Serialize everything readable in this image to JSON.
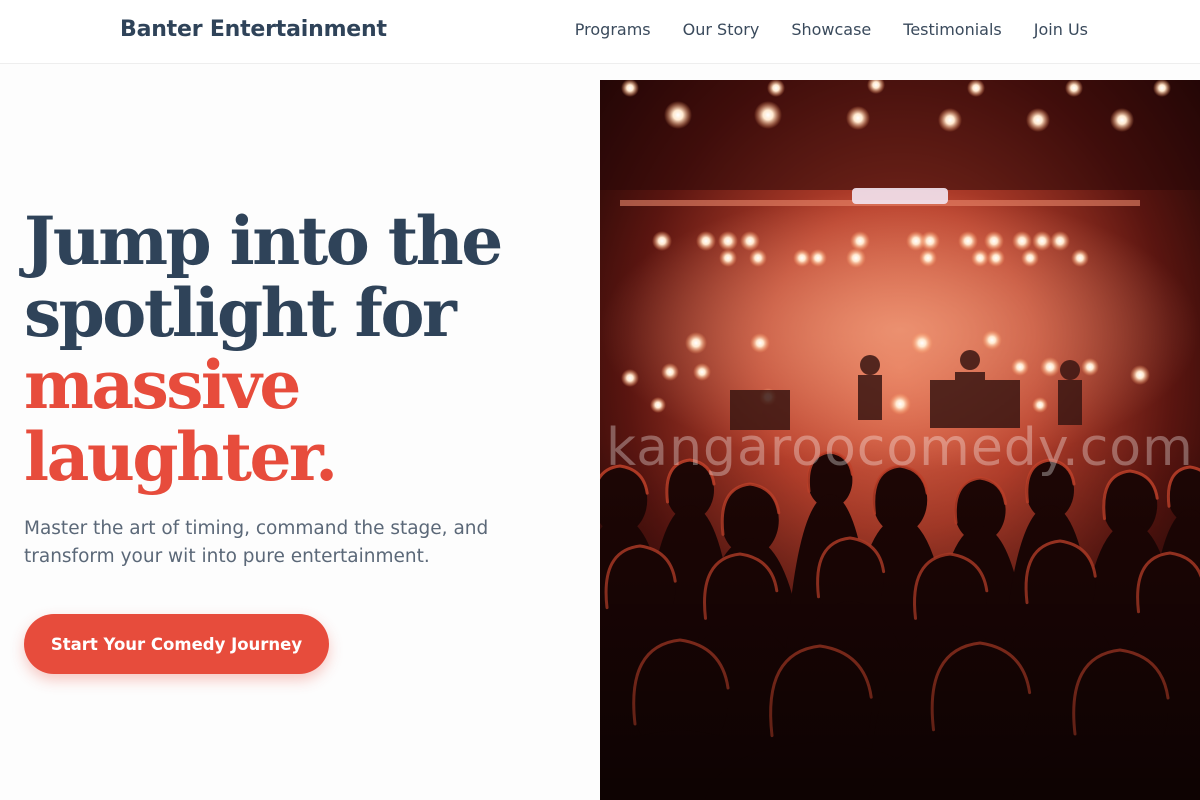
{
  "header": {
    "brand": "Banter Entertainment",
    "nav": [
      "Programs",
      "Our Story",
      "Showcase",
      "Testimonials",
      "Join Us"
    ]
  },
  "hero": {
    "headline_line1": "Jump into the",
    "headline_line2": "spotlight for",
    "headline_accent1": "massive",
    "headline_accent2": "laughter.",
    "subtitle": "Master the art of timing, command the stage, and transform your wit into pure entertainment.",
    "cta_label": "Start Your Comedy Journey",
    "image_watermark": "kangaroocomedy.com"
  },
  "colors": {
    "primary_text": "#2f4359",
    "accent": "#e74c3c",
    "muted_text": "#5b6878"
  }
}
